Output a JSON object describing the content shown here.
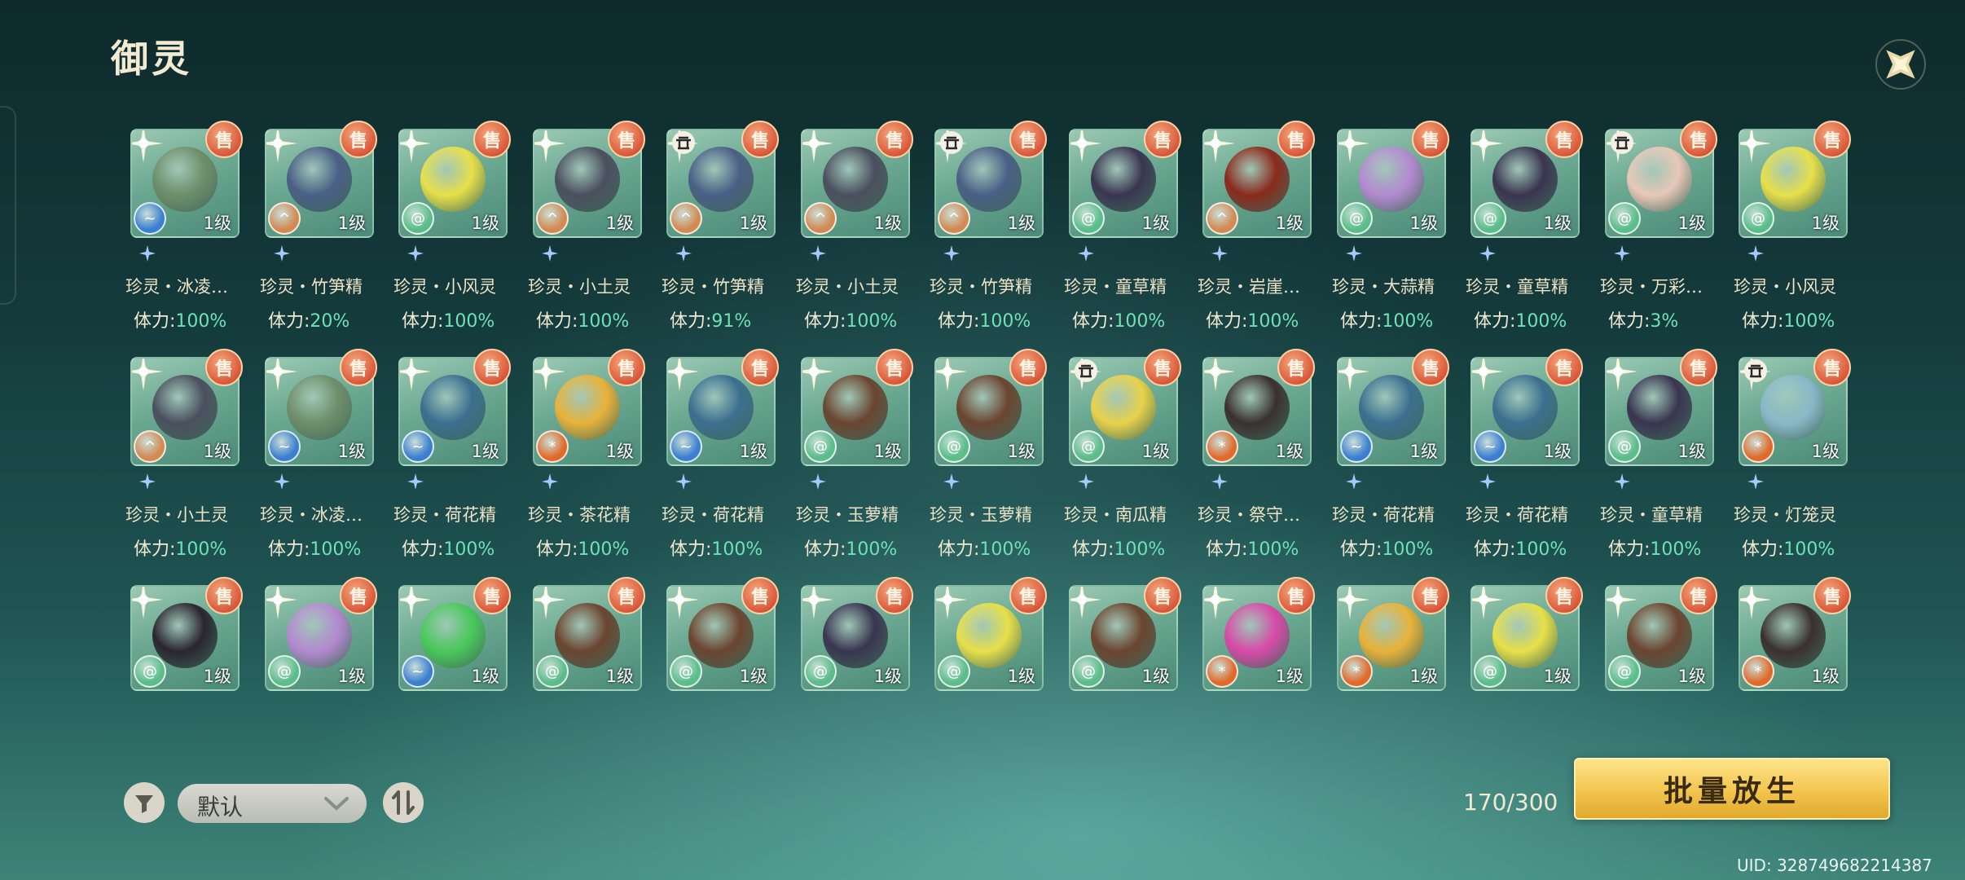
{
  "header": {
    "title": "御灵"
  },
  "icons": {
    "close": "close-x-icon",
    "filter": "filter-icon",
    "sort_order": "sort-order-icon",
    "sell": "sell-badge-icon"
  },
  "colors": {
    "stamina_value": "#6ee2b6",
    "release_button": "#f2c54e",
    "sell_badge": "#d9583a"
  },
  "rows": [
    [
      {
        "name": "珍灵・冰凌…",
        "level": "1级",
        "stamina_label": "体力:",
        "stamina": "100%",
        "element": "water",
        "locked": false,
        "creature": "#6f8f6a"
      },
      {
        "name": "珍灵・竹笋精",
        "level": "1级",
        "stamina_label": "体力:",
        "stamina": "20%",
        "element": "earth",
        "locked": false,
        "creature": "#4a5f86"
      },
      {
        "name": "珍灵・小风灵",
        "level": "1级",
        "stamina_label": "体力:",
        "stamina": "100%",
        "element": "wind",
        "locked": false,
        "creature": "#e8e04a"
      },
      {
        "name": "珍灵・小土灵",
        "level": "1级",
        "stamina_label": "体力:",
        "stamina": "100%",
        "element": "earth",
        "locked": false,
        "creature": "#4b4f5e"
      },
      {
        "name": "珍灵・竹笋精",
        "level": "1级",
        "stamina_label": "体力:",
        "stamina": "91%",
        "element": "earth",
        "locked": true,
        "creature": "#4a5f86"
      },
      {
        "name": "珍灵・小土灵",
        "level": "1级",
        "stamina_label": "体力:",
        "stamina": "100%",
        "element": "earth",
        "locked": false,
        "creature": "#4b4f5e"
      },
      {
        "name": "珍灵・竹笋精",
        "level": "1级",
        "stamina_label": "体力:",
        "stamina": "100%",
        "element": "earth",
        "locked": true,
        "creature": "#4a5f86"
      },
      {
        "name": "珍灵・童草精",
        "level": "1级",
        "stamina_label": "体力:",
        "stamina": "100%",
        "element": "wind",
        "locked": false,
        "creature": "#3a3550"
      },
      {
        "name": "珍灵・岩崖…",
        "level": "1级",
        "stamina_label": "体力:",
        "stamina": "100%",
        "element": "earth",
        "locked": false,
        "creature": "#8a2a1c"
      },
      {
        "name": "珍灵・大蒜精",
        "level": "1级",
        "stamina_label": "体力:",
        "stamina": "100%",
        "element": "wind",
        "locked": false,
        "creature": "#b48ad0"
      },
      {
        "name": "珍灵・童草精",
        "level": "1级",
        "stamina_label": "体力:",
        "stamina": "100%",
        "element": "wind",
        "locked": false,
        "creature": "#3a3550"
      },
      {
        "name": "珍灵・万彩…",
        "level": "1级",
        "stamina_label": "体力:",
        "stamina": "3%",
        "element": "wind",
        "locked": true,
        "creature": "#e8c8b8"
      },
      {
        "name": "珍灵・小风灵",
        "level": "1级",
        "stamina_label": "体力:",
        "stamina": "100%",
        "element": "wind",
        "locked": false,
        "creature": "#e8e04a"
      }
    ],
    [
      {
        "name": "珍灵・小土灵",
        "level": "1级",
        "stamina_label": "体力:",
        "stamina": "100%",
        "element": "earth",
        "locked": false,
        "creature": "#4b4f5e"
      },
      {
        "name": "珍灵・冰凌…",
        "level": "1级",
        "stamina_label": "体力:",
        "stamina": "100%",
        "element": "water",
        "locked": false,
        "creature": "#6f8f6a"
      },
      {
        "name": "珍灵・荷花精",
        "level": "1级",
        "stamina_label": "体力:",
        "stamina": "100%",
        "element": "water",
        "locked": false,
        "creature": "#3b6f8f"
      },
      {
        "name": "珍灵・茶花精",
        "level": "1级",
        "stamina_label": "体力:",
        "stamina": "100%",
        "element": "fire",
        "locked": false,
        "creature": "#e8b23a"
      },
      {
        "name": "珍灵・荷花精",
        "level": "1级",
        "stamina_label": "体力:",
        "stamina": "100%",
        "element": "water",
        "locked": false,
        "creature": "#3b6f8f"
      },
      {
        "name": "珍灵・玉萝精",
        "level": "1级",
        "stamina_label": "体力:",
        "stamina": "100%",
        "element": "wind",
        "locked": false,
        "creature": "#6b4530"
      },
      {
        "name": "珍灵・玉萝精",
        "level": "1级",
        "stamina_label": "体力:",
        "stamina": "100%",
        "element": "wind",
        "locked": false,
        "creature": "#6b4530"
      },
      {
        "name": "珍灵・南瓜精",
        "level": "1级",
        "stamina_label": "体力:",
        "stamina": "100%",
        "element": "wind",
        "locked": true,
        "creature": "#e8d24a"
      },
      {
        "name": "珍灵・祭守…",
        "level": "1级",
        "stamina_label": "体力:",
        "stamina": "100%",
        "element": "fire",
        "locked": false,
        "creature": "#3a3030"
      },
      {
        "name": "珍灵・荷花精",
        "level": "1级",
        "stamina_label": "体力:",
        "stamina": "100%",
        "element": "water",
        "locked": false,
        "creature": "#3b6f8f"
      },
      {
        "name": "珍灵・荷花精",
        "level": "1级",
        "stamina_label": "体力:",
        "stamina": "100%",
        "element": "water",
        "locked": false,
        "creature": "#3b6f8f"
      },
      {
        "name": "珍灵・童草精",
        "level": "1级",
        "stamina_label": "体力:",
        "stamina": "100%",
        "element": "wind",
        "locked": false,
        "creature": "#3a3550"
      },
      {
        "name": "珍灵・灯笼灵",
        "level": "1级",
        "stamina_label": "体力:",
        "stamina": "100%",
        "element": "fire",
        "locked": true,
        "creature": "#8ab8c8"
      }
    ],
    [
      {
        "level": "1级",
        "element": "wind",
        "creature": "#2a2530"
      },
      {
        "level": "1级",
        "element": "wind",
        "creature": "#b48ad0"
      },
      {
        "level": "1级",
        "element": "water",
        "creature": "#4ac85a"
      },
      {
        "level": "1级",
        "element": "wind",
        "creature": "#6b4530"
      },
      {
        "level": "1级",
        "element": "wind",
        "creature": "#6b4530"
      },
      {
        "level": "1级",
        "element": "wind",
        "creature": "#3a3550"
      },
      {
        "level": "1级",
        "element": "wind",
        "creature": "#e8e04a"
      },
      {
        "level": "1级",
        "element": "wind",
        "creature": "#6b4530"
      },
      {
        "level": "1级",
        "element": "fire",
        "creature": "#d84aa8"
      },
      {
        "level": "1级",
        "element": "fire",
        "creature": "#e8b23a"
      },
      {
        "level": "1级",
        "element": "wind",
        "creature": "#e8e04a"
      },
      {
        "level": "1级",
        "element": "wind",
        "creature": "#6b4530"
      },
      {
        "level": "1级",
        "element": "fire",
        "creature": "#3a3030"
      }
    ]
  ],
  "sell_label": "售",
  "footer": {
    "sort_value": "默认",
    "count": "170/300",
    "release_label": "批量放生",
    "uid": "UID: 328749682214387"
  }
}
